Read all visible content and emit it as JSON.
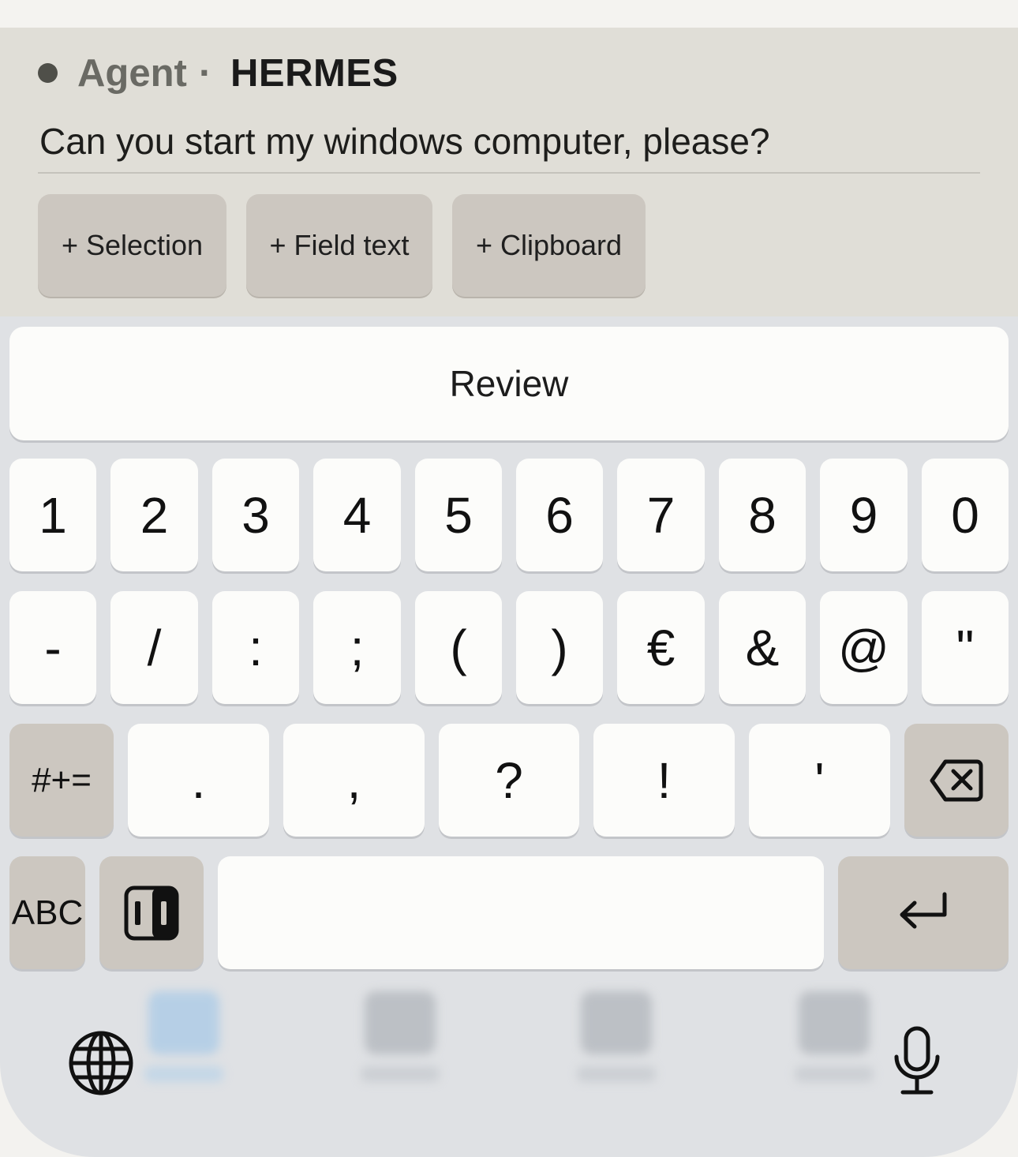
{
  "header": {
    "agent_label": "Agent",
    "separator": "·",
    "agent_name": "HERMES"
  },
  "prompt": {
    "text": "Can you start my windows computer, please?"
  },
  "chips": [
    {
      "label": "+ Selection"
    },
    {
      "label": "+ Field text"
    },
    {
      "label": "+ Clipboard"
    }
  ],
  "keyboard": {
    "suggestion": "Review",
    "row1": [
      "1",
      "2",
      "3",
      "4",
      "5",
      "6",
      "7",
      "8",
      "9",
      "0"
    ],
    "row2": [
      "-",
      "/",
      ":",
      ";",
      "(",
      ")",
      "€",
      "&",
      "@",
      "\""
    ],
    "row3": {
      "toggle": "#+=",
      "keys": [
        ".",
        ",",
        "?",
        "!",
        "'"
      ]
    },
    "row4": {
      "abc": "ABC"
    },
    "icons": {
      "backspace": "backspace-icon",
      "return": "return-icon",
      "globe": "globe-icon",
      "mic": "microphone-icon",
      "split": "keyboard-layout-icon"
    }
  }
}
